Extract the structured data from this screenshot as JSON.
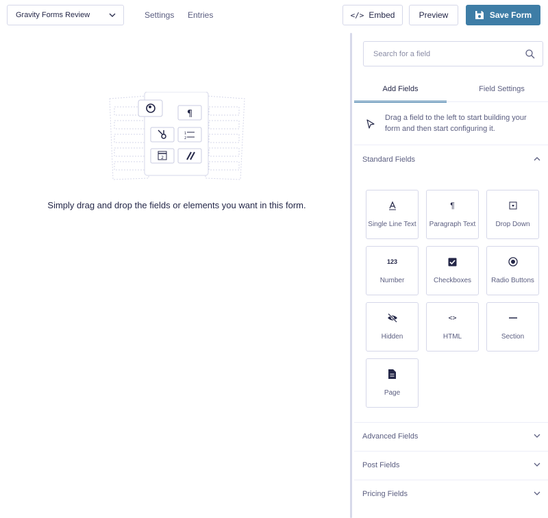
{
  "header": {
    "form_name": "Gravity Forms Review",
    "nav": {
      "settings": "Settings",
      "entries": "Entries"
    },
    "embed_label": "Embed",
    "embed_glyph": "</>",
    "preview_label": "Preview",
    "save_label": "Save Form",
    "save_color": "#3e7da6"
  },
  "canvas": {
    "empty_message": "Simply drag and drop the fields or elements you want in this form."
  },
  "sidebar": {
    "search_placeholder": "Search for a field",
    "tabs": {
      "add_fields": "Add Fields",
      "field_settings": "Field Settings"
    },
    "hint": "Drag a field to the left to start building your form and then start configuring it.",
    "sections": {
      "standard": "Standard Fields",
      "advanced": "Advanced Fields",
      "post": "Post Fields",
      "pricing": "Pricing Fields"
    },
    "standard_fields": [
      {
        "label": "Single Line Text",
        "icon": "text-line-icon"
      },
      {
        "label": "Paragraph Text",
        "icon": "paragraph-icon"
      },
      {
        "label": "Drop Down",
        "icon": "dropdown-icon"
      },
      {
        "label": "Number",
        "icon": "number-icon",
        "glyph": "123"
      },
      {
        "label": "Checkboxes",
        "icon": "checkbox-icon"
      },
      {
        "label": "Radio Buttons",
        "icon": "radio-icon"
      },
      {
        "label": "Hidden",
        "icon": "eye-slash-icon"
      },
      {
        "label": "HTML",
        "icon": "code-icon",
        "glyph": "<>"
      },
      {
        "label": "Section",
        "icon": "section-icon"
      },
      {
        "label": "Page",
        "icon": "page-icon"
      }
    ]
  }
}
